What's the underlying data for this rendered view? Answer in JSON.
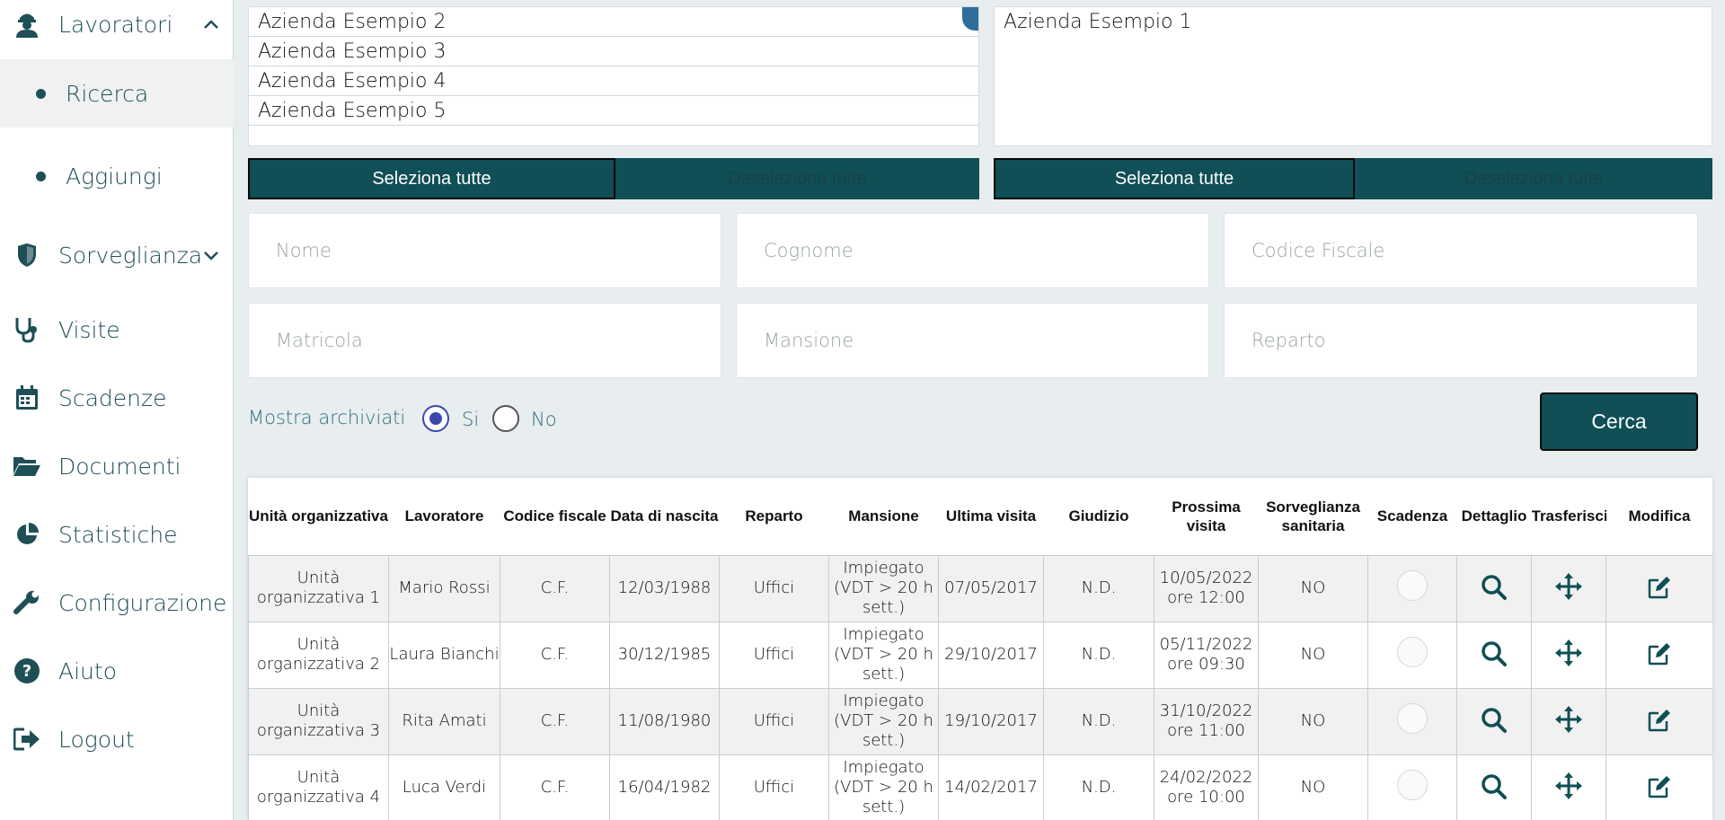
{
  "sidebar": {
    "lavoratori": "Lavoratori",
    "ricerca": "Ricerca",
    "aggiungi": "Aggiungi",
    "sorveglianza": "Sorveglianza",
    "visite": "Visite",
    "scadenze": "Scadenze",
    "documenti": "Documenti",
    "statistiche": "Statistiche",
    "configurazione": "Configurazione",
    "aiuto": "Aiuto",
    "logout": "Logout"
  },
  "companies_available": [
    "Azienda Esempio 2",
    "Azienda Esempio 3",
    "Azienda Esempio 4",
    "Azienda Esempio 5"
  ],
  "companies_selected": [
    "Azienda Esempio 1"
  ],
  "buttons": {
    "select_all": "Seleziona tutte",
    "deselect_all": "Deseleziona tutte",
    "search": "Cerca"
  },
  "filters": {
    "nome": "Nome",
    "cognome": "Cognome",
    "codice_fiscale": "Codice Fiscale",
    "matricola": "Matricola",
    "mansione": "Mansione",
    "reparto": "Reparto"
  },
  "archived": {
    "label": "Mostra archiviati",
    "yes": "Si",
    "no": "No",
    "selected": "Si"
  },
  "table": {
    "headers": [
      "Unità organizzativa",
      "Lavoratore",
      "Codice fiscale",
      "Data di nascita",
      "Reparto",
      "Mansione",
      "Ultima visita",
      "Giudizio",
      "Prossima visita",
      "Sorveglianza sanitaria",
      "Scadenza",
      "Dettaglio",
      "Trasferisci",
      "Modifica"
    ],
    "rows": [
      {
        "unita": "Unità organizzativa 1",
        "lavoratore": "Mario Rossi",
        "cf": "C.F.",
        "nascita": "12/03/1988",
        "reparto": "Uffici",
        "mansione": "Impiegato (VDT > 20 h sett.)",
        "ultima": "07/05/2017",
        "giudizio": "N.D.",
        "prossima": "10/05/2022 ore 12:00",
        "sorveglianza": "NO"
      },
      {
        "unita": "Unità organizzativa 2",
        "lavoratore": "Laura Bianchi",
        "cf": "C.F.",
        "nascita": "30/12/1985",
        "reparto": "Uffici",
        "mansione": "Impiegato (VDT > 20 h sett.)",
        "ultima": "29/10/2017",
        "giudizio": "N.D.",
        "prossima": "05/11/2022 ore 09:30",
        "sorveglianza": "NO"
      },
      {
        "unita": "Unità organizzativa 3",
        "lavoratore": "Rita Amati",
        "cf": "C.F.",
        "nascita": "11/08/1980",
        "reparto": "Uffici",
        "mansione": "Impiegato (VDT > 20 h sett.)",
        "ultima": "19/10/2017",
        "giudizio": "N.D.",
        "prossima": "31/10/2022 ore 11:00",
        "sorveglianza": "NO"
      },
      {
        "unita": "Unità organizzativa 4",
        "lavoratore": "Luca Verdi",
        "cf": "C.F.",
        "nascita": "16/04/1982",
        "reparto": "Uffici",
        "mansione": "Impiegato (VDT > 20 h sett.)",
        "ultima": "14/02/2017",
        "giudizio": "N.D.",
        "prossima": "24/02/2022 ore 10:00",
        "sorveglianza": "NO"
      }
    ]
  },
  "icons": {
    "lavoratori": "worker-icon",
    "sorveglianza": "shield-icon",
    "visite": "stethoscope-icon",
    "scadenze": "calendar-icon",
    "documenti": "folder-open-icon",
    "statistiche": "pie-chart-icon",
    "configurazione": "wrench-icon",
    "aiuto": "help-icon",
    "logout": "logout-icon",
    "dettaglio": "search-icon",
    "trasferisci": "move-icon",
    "modifica": "edit-icon"
  },
  "colors": {
    "primary": "#0f4f55",
    "nav_text": "#1e4f57",
    "radio_accent": "#3949ab",
    "radio_label": "#2b6f7a"
  }
}
